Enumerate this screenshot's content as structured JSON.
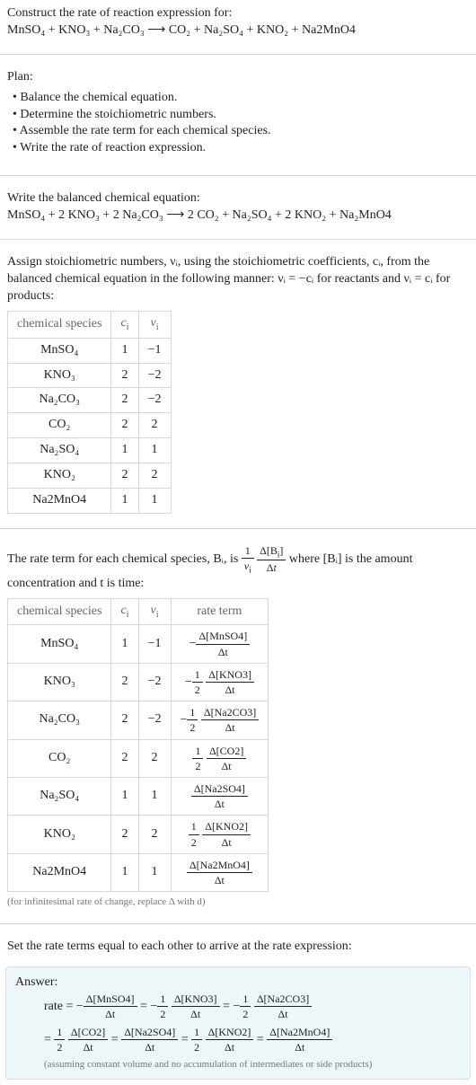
{
  "intro": {
    "prompt": "Construct the rate of reaction expression for:",
    "unbalanced": "MnSO₄ + KNO₃ + Na₂CO₃ ⟶ CO₂ + Na₂SO₄ + KNO₂ + Na2MnO4"
  },
  "plan": {
    "heading": "Plan:",
    "items": [
      "Balance the chemical equation.",
      "Determine the stoichiometric numbers.",
      "Assemble the rate term for each chemical species.",
      "Write the rate of reaction expression."
    ]
  },
  "balanced": {
    "heading": "Write the balanced chemical equation:",
    "eqn": "MnSO₄ + 2 KNO₃ + 2 Na₂CO₃ ⟶ 2 CO₂ + Na₂SO₄ + 2 KNO₂ + Na₂MnO4"
  },
  "stoich": {
    "heading_a": "Assign stoichiometric numbers, νᵢ, using the stoichiometric coefficients, cᵢ, from the balanced chemical equation in the following manner: νᵢ = −cᵢ for reactants and νᵢ = cᵢ for products:",
    "headers": [
      "chemical species",
      "cᵢ",
      "νᵢ"
    ],
    "rows": [
      {
        "sp": "MnSO₄",
        "c": "1",
        "v": "−1"
      },
      {
        "sp": "KNO₃",
        "c": "2",
        "v": "−2"
      },
      {
        "sp": "Na₂CO₃",
        "c": "2",
        "v": "−2"
      },
      {
        "sp": "CO₂",
        "c": "2",
        "v": "2"
      },
      {
        "sp": "Na₂SO₄",
        "c": "1",
        "v": "1"
      },
      {
        "sp": "KNO₂",
        "c": "2",
        "v": "2"
      },
      {
        "sp": "Na2MnO4",
        "c": "1",
        "v": "1"
      }
    ]
  },
  "rateterm_intro": {
    "pre": "The rate term for each chemical species, Bᵢ, is ",
    "post": " where [Bᵢ] is the amount concentration and t is time:"
  },
  "rateterm_table": {
    "headers": [
      "chemical species",
      "cᵢ",
      "νᵢ",
      "rate term"
    ],
    "rows": [
      {
        "sp": "MnSO₄",
        "c": "1",
        "v": "−1",
        "neg": "−",
        "coef": "",
        "num": "Δ[MnSO4]",
        "den": "Δt"
      },
      {
        "sp": "KNO₃",
        "c": "2",
        "v": "−2",
        "neg": "−",
        "coef": "½",
        "num": "Δ[KNO3]",
        "den": "Δt"
      },
      {
        "sp": "Na₂CO₃",
        "c": "2",
        "v": "−2",
        "neg": "−",
        "coef": "½",
        "num": "Δ[Na2CO3]",
        "den": "Δt"
      },
      {
        "sp": "CO₂",
        "c": "2",
        "v": "2",
        "neg": "",
        "coef": "½",
        "num": "Δ[CO2]",
        "den": "Δt"
      },
      {
        "sp": "Na₂SO₄",
        "c": "1",
        "v": "1",
        "neg": "",
        "coef": "",
        "num": "Δ[Na2SO4]",
        "den": "Δt"
      },
      {
        "sp": "KNO₂",
        "c": "2",
        "v": "2",
        "neg": "",
        "coef": "½",
        "num": "Δ[KNO2]",
        "den": "Δt"
      },
      {
        "sp": "Na2MnO4",
        "c": "1",
        "v": "1",
        "neg": "",
        "coef": "",
        "num": "Δ[Na2MnO4]",
        "den": "Δt"
      }
    ],
    "note": "(for infinitesimal rate of change, replace Δ with d)"
  },
  "conclude": "Set the rate terms equal to each other to arrive at the rate expression:",
  "answer": {
    "label": "Answer:",
    "rate_lhs": "rate = ",
    "terms_line1": [
      {
        "neg": "−",
        "coef": "",
        "num": "Δ[MnSO4]",
        "den": "Δt"
      },
      {
        "neg": "−",
        "coef": "½",
        "num": "Δ[KNO3]",
        "den": "Δt"
      },
      {
        "neg": "−",
        "coef": "½",
        "num": "Δ[Na2CO3]",
        "den": "Δt"
      }
    ],
    "terms_line2": [
      {
        "neg": "",
        "coef": "½",
        "num": "Δ[CO2]",
        "den": "Δt"
      },
      {
        "neg": "",
        "coef": "",
        "num": "Δ[Na2SO4]",
        "den": "Δt"
      },
      {
        "neg": "",
        "coef": "½",
        "num": "Δ[KNO2]",
        "den": "Δt"
      },
      {
        "neg": "",
        "coef": "",
        "num": "Δ[Na2MnO4]",
        "den": "Δt"
      }
    ],
    "assumption": "(assuming constant volume and no accumulation of intermediates or side products)"
  }
}
